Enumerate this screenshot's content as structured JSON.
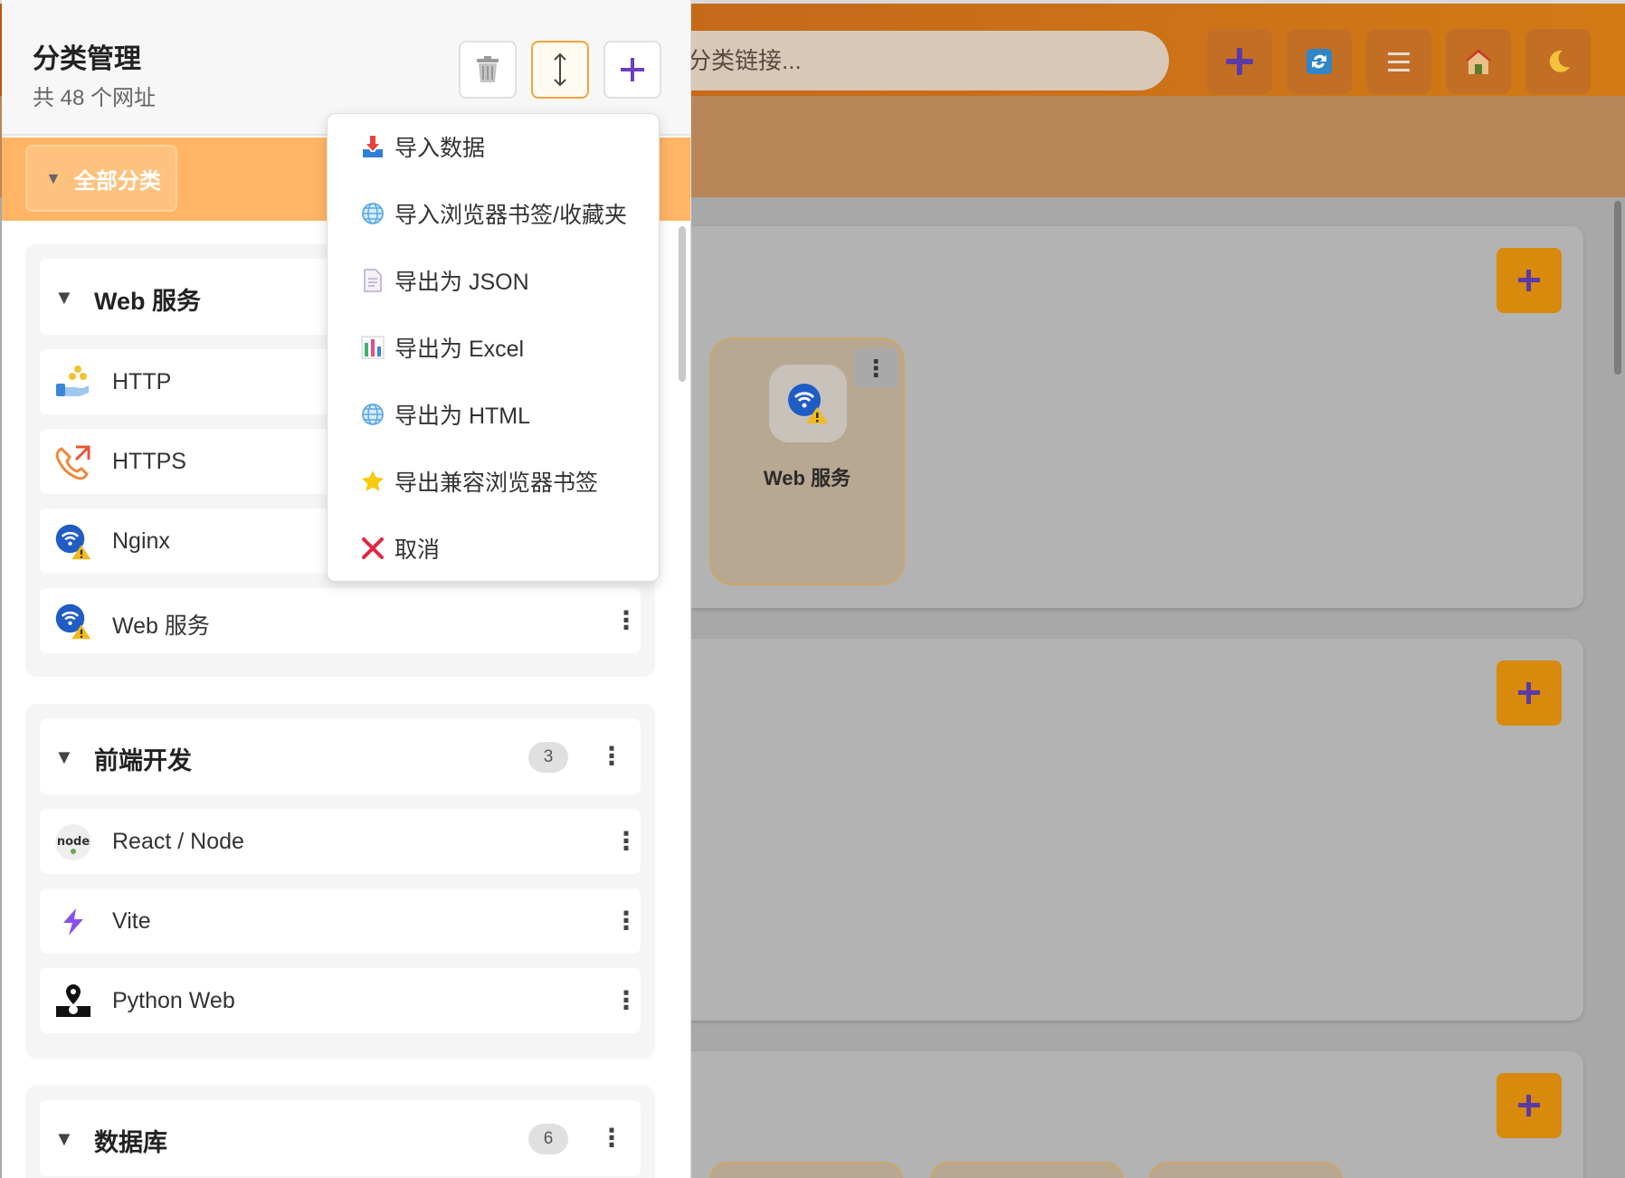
{
  "panel": {
    "title": "分类管理",
    "count": "共 48 个网址",
    "all_categories": "全部分类"
  },
  "search": {
    "placeholder": "分类链接..."
  },
  "menu": {
    "items": [
      {
        "label": "导入数据",
        "icon": "import-tray-icon"
      },
      {
        "label": "导入浏览器书签/收藏夹",
        "icon": "globe-icon"
      },
      {
        "label": "导出为 JSON",
        "icon": "document-icon"
      },
      {
        "label": "导出为 Excel",
        "icon": "bar-chart-icon"
      },
      {
        "label": "导出为 HTML",
        "icon": "globe-icon"
      },
      {
        "label": "导出兼容浏览器书签",
        "icon": "star-icon"
      },
      {
        "label": "取消",
        "icon": "cross-icon"
      }
    ]
  },
  "groups": [
    {
      "name": "Web 服务",
      "items": [
        "HTTP",
        "HTTPS",
        "Nginx",
        "Web 服务"
      ]
    },
    {
      "name": "前端开发",
      "count": "3",
      "items": [
        "React / Node",
        "Vite",
        "Python Web"
      ]
    },
    {
      "name": "数据库",
      "count": "6"
    }
  ],
  "main": {
    "tile_label": "Web 服务"
  },
  "colors": {
    "accent": "#f39a23",
    "add_purple": "#6c3fc1"
  }
}
